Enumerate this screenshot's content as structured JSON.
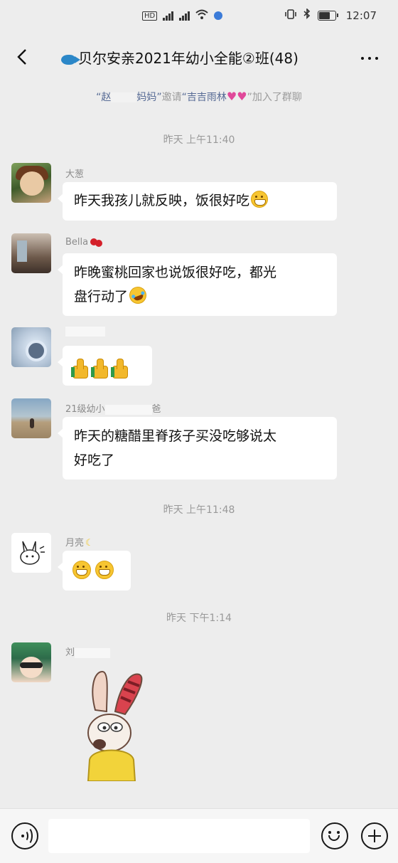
{
  "status_bar": {
    "time": "12:07",
    "icons": [
      "hd-icon",
      "signal-4g-icon",
      "signal-icon",
      "wifi-icon",
      "app-notification-icon",
      "vibrate-icon",
      "bluetooth-icon",
      "battery-icon"
    ]
  },
  "header": {
    "title": "贝尔安亲2021年幼小全能②班(48)",
    "back_icon": "chevron-left-icon",
    "more_icon": "more-dots-icon"
  },
  "system_message": {
    "inviter_visible": "“赵",
    "inviter_suffix": "妈妈”",
    "verb": "邀请",
    "invitee": "“吉吉雨林",
    "invitee_emoji": "two-hearts-emoji",
    "action": "”加入了群聊"
  },
  "messages": [
    {
      "type": "time",
      "text": "昨天 上午11:40"
    },
    {
      "type": "chat",
      "sender": "大葱",
      "text": "昨天我孩儿就反映，饭很好吃",
      "emoji": "grin-emoji"
    },
    {
      "type": "chat",
      "sender": "Bella",
      "sender_emoji": "cherry-emoji",
      "line1": "昨晚蜜桃回家也说饭很好吃，都光",
      "line2": "盘行动了",
      "emoji": "laugh-tears-emoji"
    },
    {
      "type": "chat",
      "sender": "",
      "emoji": "thumbs-up-emoji",
      "emoji_count": 3
    },
    {
      "type": "chat",
      "sender": "21级幼小",
      "sender_suffix": "爸",
      "line1": "昨天的糖醋里脊孩子买没吃够说太",
      "line2": "好吃了"
    },
    {
      "type": "time",
      "text": "昨天 上午11:48"
    },
    {
      "type": "chat",
      "sender": "月亮",
      "sender_emoji": "crescent-moon-emoji",
      "emoji": "grin-emoji",
      "emoji_count": 2
    },
    {
      "type": "time",
      "text": "昨天 下午1:14"
    },
    {
      "type": "chat",
      "sender": "刘",
      "sticker": "cartoon-rabbit-sticker"
    }
  ],
  "input_bar": {
    "voice_icon": "voice-icon",
    "emoji_icon": "smile-icon",
    "plus_icon": "plus-icon"
  },
  "colors": {
    "background": "#ededed",
    "bubble": "#ffffff",
    "link": "#576b95",
    "timestamp": "#999999"
  }
}
